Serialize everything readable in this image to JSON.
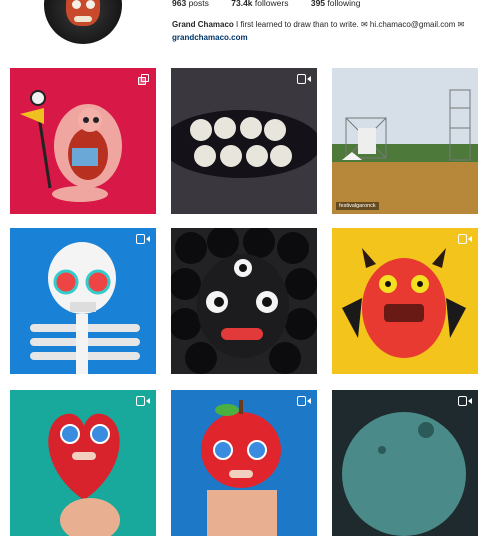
{
  "profile": {
    "posts": "963",
    "posts_label": "posts",
    "followers": "73.4k",
    "followers_label": "followers",
    "following": "395",
    "following_label": "following",
    "name": "Grand Chamaco",
    "bio": " I first learned to draw than to write. ✉ hi.chamaco@gmail.com ✉",
    "website": "grandchamaco.com"
  },
  "grid": {
    "tile_6_tag": "festivalgaronck"
  },
  "icons": {
    "video": "video-camera-icon",
    "multiple": "multiple-posts-icon"
  },
  "colors": {
    "link": "#003569",
    "text": "#262626"
  }
}
